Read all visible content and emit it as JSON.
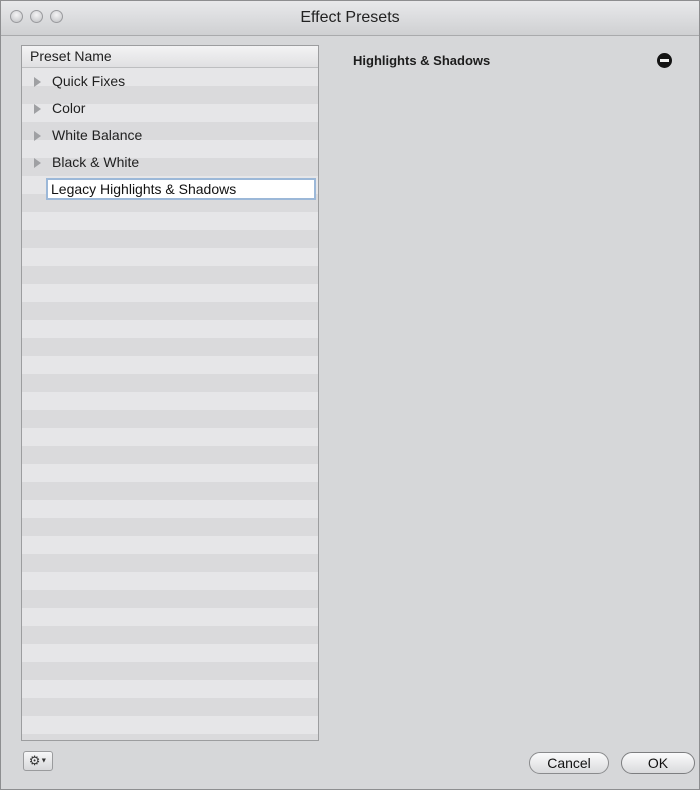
{
  "window": {
    "title": "Effect Presets"
  },
  "list": {
    "header": "Preset Name",
    "items": [
      {
        "label": "Quick Fixes",
        "collapsed": true
      },
      {
        "label": "Color",
        "collapsed": true
      },
      {
        "label": "White Balance",
        "collapsed": true
      },
      {
        "label": "Black & White",
        "collapsed": true
      }
    ],
    "editing_value": "Legacy Highlights & Shadows"
  },
  "detail": {
    "title": "Highlights & Shadows"
  },
  "footer": {
    "gear_icon": "gear-icon",
    "cancel_label": "Cancel",
    "ok_label": "OK"
  },
  "colors": {
    "window_bg": "#d6d7d9",
    "list_bg": "#e6e6e8",
    "edit_border": "#9cb8d8"
  }
}
